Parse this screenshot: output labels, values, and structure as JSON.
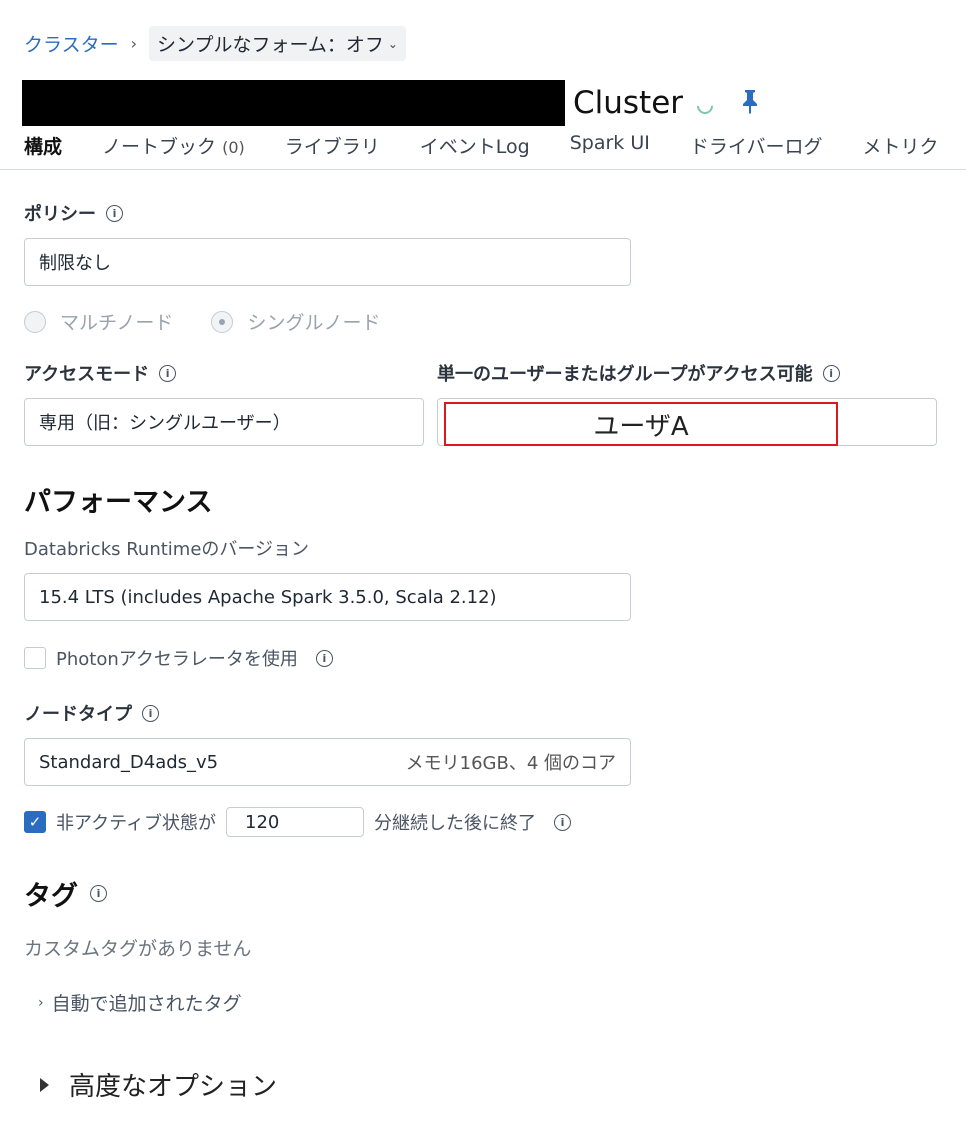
{
  "breadcrumb": {
    "parent": "クラスター",
    "separator": "›",
    "current": "シンプルなフォーム：オフ"
  },
  "title": {
    "name": "Cluster"
  },
  "tabs": [
    {
      "label": "構成"
    },
    {
      "label": "ノートブック",
      "count": "(0)"
    },
    {
      "label": "ライブラリ"
    },
    {
      "label": "イベントLog"
    },
    {
      "label": "Spark UI"
    },
    {
      "label": "ドライバーログ"
    },
    {
      "label": "メトリク"
    }
  ],
  "policy": {
    "label": "ポリシー",
    "value": "制限なし"
  },
  "node_mode": {
    "multi": "マルチノード",
    "single": "シングルノード",
    "selected": "single"
  },
  "access": {
    "mode_label": "アクセスモード",
    "mode_value": "専用（旧：シングルユーザー）",
    "user_label": "単一のユーザーまたはグループがアクセス可能",
    "user_value": "ユーザA"
  },
  "performance": {
    "title": "パフォーマンス",
    "runtime_label": "Databricks Runtimeのバージョン",
    "runtime_value": "15.4 LTS (includes Apache Spark 3.5.0, Scala 2.12)",
    "photon_label": "Photonアクセラレータを使用",
    "photon_checked": false,
    "node_type_label": "ノードタイプ",
    "node_type_value": "Standard_D4ads_v5",
    "node_type_spec": "メモリ16GB、4 個のコア",
    "inactive_prefix": "非アクティブ状態が",
    "inactive_minutes": "120",
    "inactive_suffix": "分継続した後に終了",
    "inactive_checked": true
  },
  "tags": {
    "title": "タグ",
    "empty": "カスタムタグがありません",
    "auto": "自動で追加されたタグ"
  },
  "advanced": {
    "label": "高度なオプション"
  },
  "colors": {
    "accent": "#2a6cbf",
    "highlight": "#d71920"
  }
}
